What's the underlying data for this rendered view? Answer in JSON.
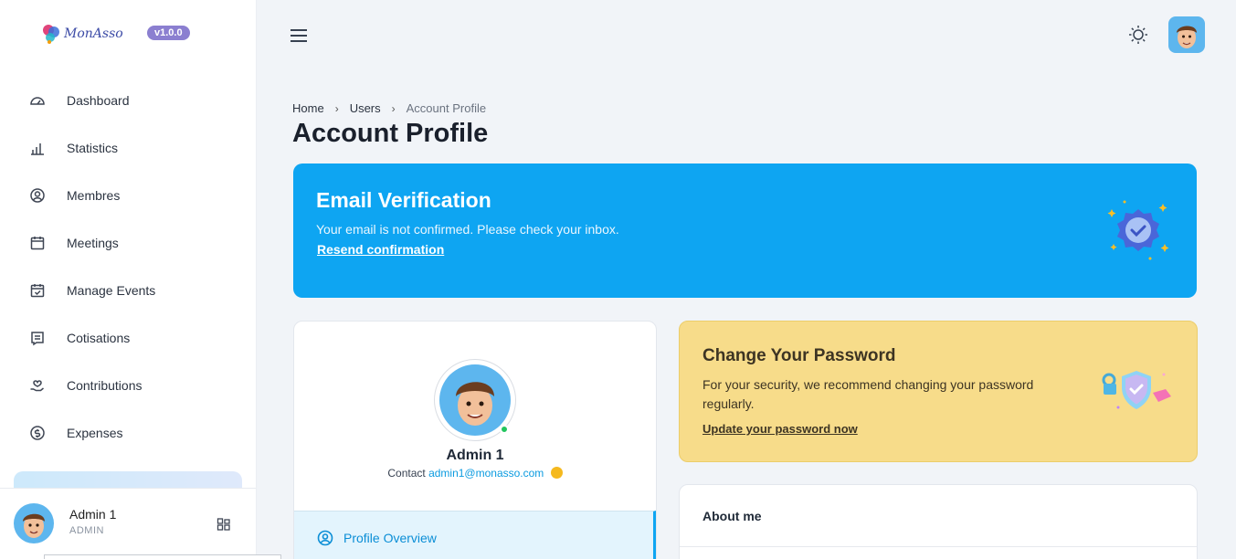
{
  "brand": {
    "name": "MonAsso",
    "version": "v1.0.0"
  },
  "sidebar": {
    "items": [
      {
        "label": "Dashboard",
        "icon": "dashboard-gauge-icon"
      },
      {
        "label": "Statistics",
        "icon": "bar-chart-icon"
      },
      {
        "label": "Membres",
        "icon": "user-circle-icon"
      },
      {
        "label": "Meetings",
        "icon": "calendar-icon"
      },
      {
        "label": "Manage Events",
        "icon": "calendar-check-icon"
      },
      {
        "label": "Cotisations",
        "icon": "receipt-icon"
      },
      {
        "label": "Contributions",
        "icon": "hand-heart-icon"
      },
      {
        "label": "Expenses",
        "icon": "dollar-circle-icon"
      }
    ],
    "user": {
      "name": "Admin 1",
      "role": "ADMIN"
    }
  },
  "breadcrumb": {
    "home": "Home",
    "users": "Users",
    "current": "Account Profile"
  },
  "page": {
    "title": "Account Profile"
  },
  "email_banner": {
    "title": "Email Verification",
    "text": "Your email is not confirmed. Please check your inbox.",
    "link": "Resend confirmation",
    "color": "#0ea5f2"
  },
  "profile": {
    "name": "Admin 1",
    "contact_label": "Contact",
    "email": "admin1@monasso.com",
    "tab_label": "Profile Overview"
  },
  "password_card": {
    "title": "Change Your Password",
    "text": "For your security, we recommend changing your password regularly.",
    "link": "Update your password now",
    "color": "#f7dc8a"
  },
  "about": {
    "title": "About me"
  }
}
